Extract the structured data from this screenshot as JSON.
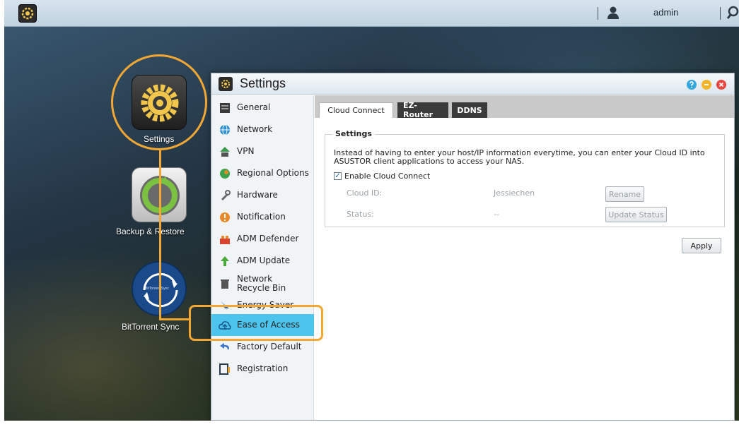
{
  "taskbar": {
    "user_name": "admin"
  },
  "desktop": {
    "apps": [
      {
        "label": "Settings"
      },
      {
        "label": "Backup & Restore"
      },
      {
        "label": "BitTorrent Sync"
      }
    ],
    "bittorrent_badge": "BitTorrent Sync"
  },
  "window": {
    "title": "Settings",
    "sidebar": {
      "items": [
        {
          "label": "General",
          "icon": "general-icon"
        },
        {
          "label": "Network",
          "icon": "network-icon"
        },
        {
          "label": "VPN",
          "icon": "vpn-icon"
        },
        {
          "label": "Regional Options",
          "icon": "regional-icon"
        },
        {
          "label": "Hardware",
          "icon": "hardware-icon"
        },
        {
          "label": "Notification",
          "icon": "notification-icon"
        },
        {
          "label": "ADM Defender",
          "icon": "defender-icon"
        },
        {
          "label": "ADM Update",
          "icon": "update-icon"
        },
        {
          "label": "Network Recycle Bin",
          "icon": "recycle-bin-icon"
        },
        {
          "label": "Energy Saver",
          "icon": "energy-icon"
        },
        {
          "label": "Ease of Access",
          "icon": "cloud-icon",
          "active": true
        },
        {
          "label": "Factory Default",
          "icon": "factory-icon"
        },
        {
          "label": "Registration",
          "icon": "registration-icon"
        }
      ]
    },
    "tabs": [
      {
        "label": "Cloud Connect",
        "active": true
      },
      {
        "label": "EZ-Router",
        "active": false
      },
      {
        "label": "DDNS",
        "active": false
      }
    ],
    "settings_group": {
      "legend": "Settings",
      "description": "Instead of having to enter your host/IP information everytime, you can enter your Cloud ID into ASUSTOR client applications to access your NAS.",
      "enable_label": "Enable Cloud Connect",
      "enable_checked": true,
      "cloud_id_label": "Cloud ID:",
      "cloud_id_value": "Jessiechen",
      "status_label": "Status:",
      "status_value": "--",
      "rename_button": "Rename",
      "update_status_button": "Update Status"
    },
    "apply_button": "Apply"
  },
  "colors": {
    "highlight": "#f3a733",
    "active_nav": "#4cc4ec",
    "help": "#34a6e0",
    "minimize": "#f5b52a",
    "close": "#e6473f"
  }
}
